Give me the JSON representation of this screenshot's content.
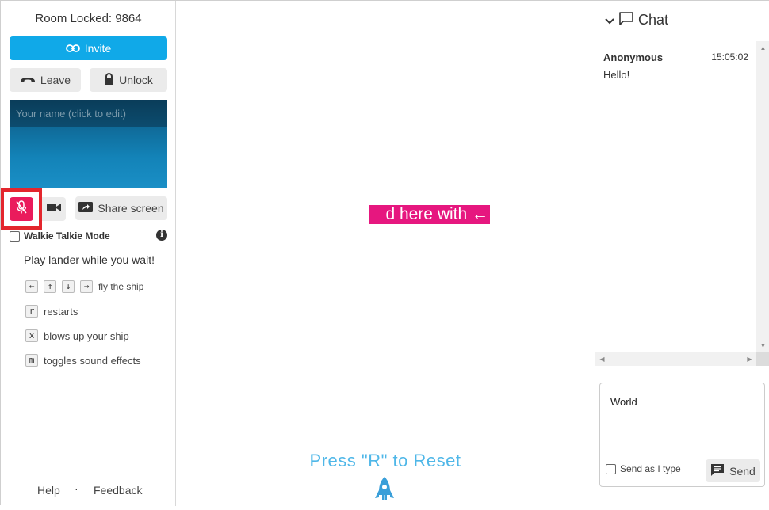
{
  "room": {
    "title": "Room Locked: 9864"
  },
  "controls": {
    "invite_label": "Invite",
    "leave_label": "Leave",
    "unlock_label": "Unlock",
    "share_label": "Share screen",
    "mic_state": "muted"
  },
  "video": {
    "name_placeholder": "Your name (click to edit)"
  },
  "walkie": {
    "label": "Walkie Talkie Mode",
    "checked": false
  },
  "game_help": {
    "wait_text": "Play lander while you wait!",
    "fly_keys": [
      "←",
      "↑",
      "↓",
      "→"
    ],
    "fly_text": "fly the ship",
    "rows": [
      {
        "key": "r",
        "text": "restarts"
      },
      {
        "key": "x",
        "text": "blows up your ship"
      },
      {
        "key": "m",
        "text": "toggles sound effects"
      }
    ]
  },
  "footer": {
    "help": "Help",
    "separator": "·",
    "feedback": "Feedback"
  },
  "game": {
    "banner_text": "d here with ←",
    "reset_text": "Press \"R\" to Reset"
  },
  "chat": {
    "title": "Chat",
    "messages": [
      {
        "author": "Anonymous",
        "time": "15:05:02",
        "text": "Hello!"
      }
    ],
    "input_value": "World",
    "send_as_label": "Send as I type",
    "send_label": "Send"
  },
  "colors": {
    "accent_blue": "#10a9e8",
    "mic_red": "#ea1b5c",
    "highlight_border": "#e3262d",
    "banner_pink": "#e6177f",
    "reset_text": "#4fb7e8"
  }
}
